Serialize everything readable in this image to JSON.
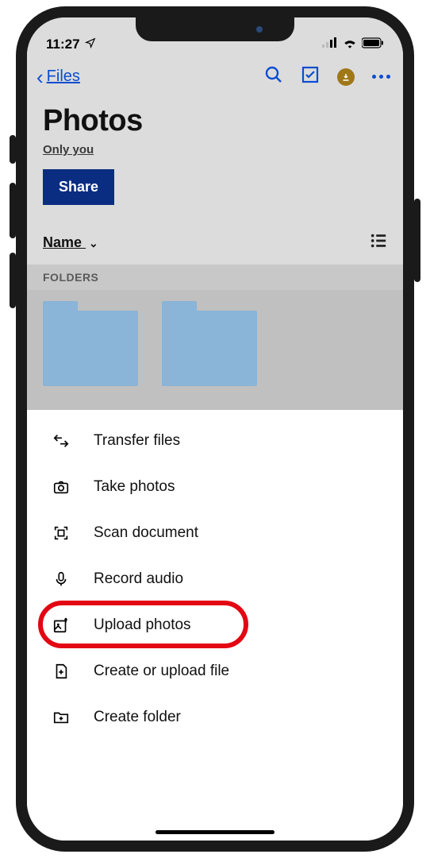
{
  "status": {
    "time": "11:27"
  },
  "nav": {
    "back_label": "Files"
  },
  "page": {
    "title": "Photos",
    "subtitle": "Only you",
    "share_label": "Share"
  },
  "sort": {
    "label": "Name"
  },
  "section": {
    "folders_header": "FOLDERS"
  },
  "sheet": {
    "items": [
      {
        "id": "transfer",
        "label": "Transfer files"
      },
      {
        "id": "take",
        "label": "Take photos"
      },
      {
        "id": "scan",
        "label": "Scan document"
      },
      {
        "id": "record",
        "label": "Record audio"
      },
      {
        "id": "upload",
        "label": "Upload photos"
      },
      {
        "id": "createfile",
        "label": "Create or upload file"
      },
      {
        "id": "createfolder",
        "label": "Create folder"
      }
    ]
  },
  "highlight_index": 4
}
